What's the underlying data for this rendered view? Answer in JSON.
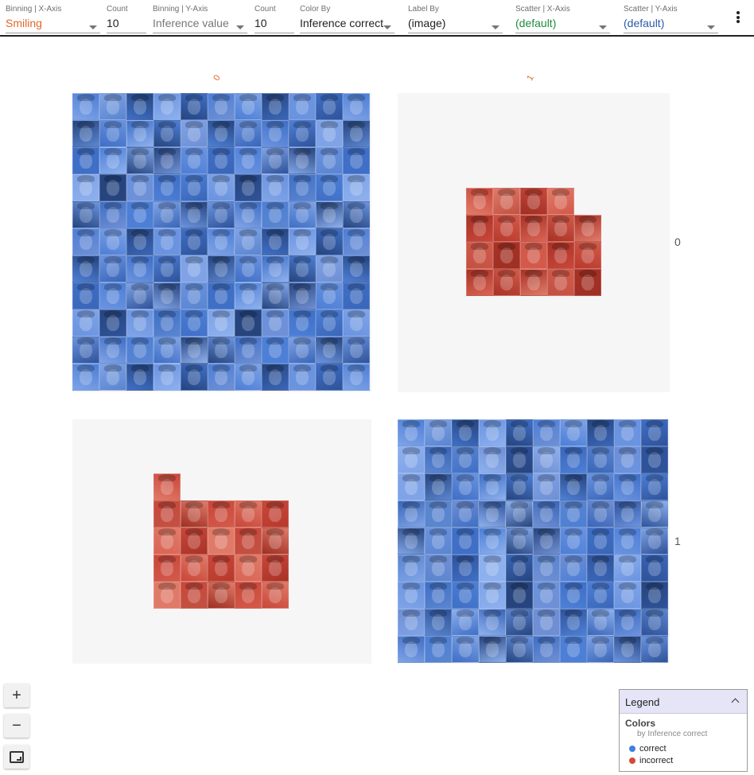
{
  "toolbar": {
    "binning_x": {
      "label": "Binning | X-Axis",
      "value": "Smiling",
      "color": "#e0672a"
    },
    "count_x": {
      "label": "Count",
      "value": "10"
    },
    "binning_y": {
      "label": "Binning | Y-Axis",
      "value": "Inference value",
      "color": "#777777"
    },
    "count_y": {
      "label": "Count",
      "value": "10"
    },
    "color_by": {
      "label": "Color By",
      "value": "Inference correct",
      "color": "#222222"
    },
    "label_by": {
      "label": "Label By",
      "value": "(image)",
      "color": "#222222"
    },
    "scatter_x": {
      "label": "Scatter | X-Axis",
      "value": "(default)",
      "color": "#1e8a3c"
    },
    "scatter_y": {
      "label": "Scatter | Y-Axis",
      "value": "(default)",
      "color": "#2c5aa8"
    },
    "menu_icon": "more-vert-icon"
  },
  "facets": {
    "columns": [
      "0",
      "1"
    ],
    "rows": [
      "0",
      "1"
    ],
    "cells": [
      {
        "name": "cell-0-0",
        "column": "0",
        "row": "0",
        "category": "correct",
        "count": 121
      },
      {
        "name": "cell-1-0",
        "column": "1",
        "row": "0",
        "category": "incorrect",
        "count": 19
      },
      {
        "name": "cell-0-1",
        "column": "0",
        "row": "1",
        "category": "incorrect",
        "count": 21
      },
      {
        "name": "cell-1-1",
        "column": "1",
        "row": "1",
        "category": "correct",
        "count": 90
      }
    ]
  },
  "zoom_controls": {
    "zoom_in": "+",
    "zoom_out": "−",
    "fit_icon": "fit-screen-icon"
  },
  "legend": {
    "title": "Legend",
    "section": "Colors",
    "subtitle": "by Inference correct",
    "items": [
      {
        "label": "correct",
        "color": "#3f7fe0"
      },
      {
        "label": "incorrect",
        "color": "#d8473a"
      }
    ]
  }
}
